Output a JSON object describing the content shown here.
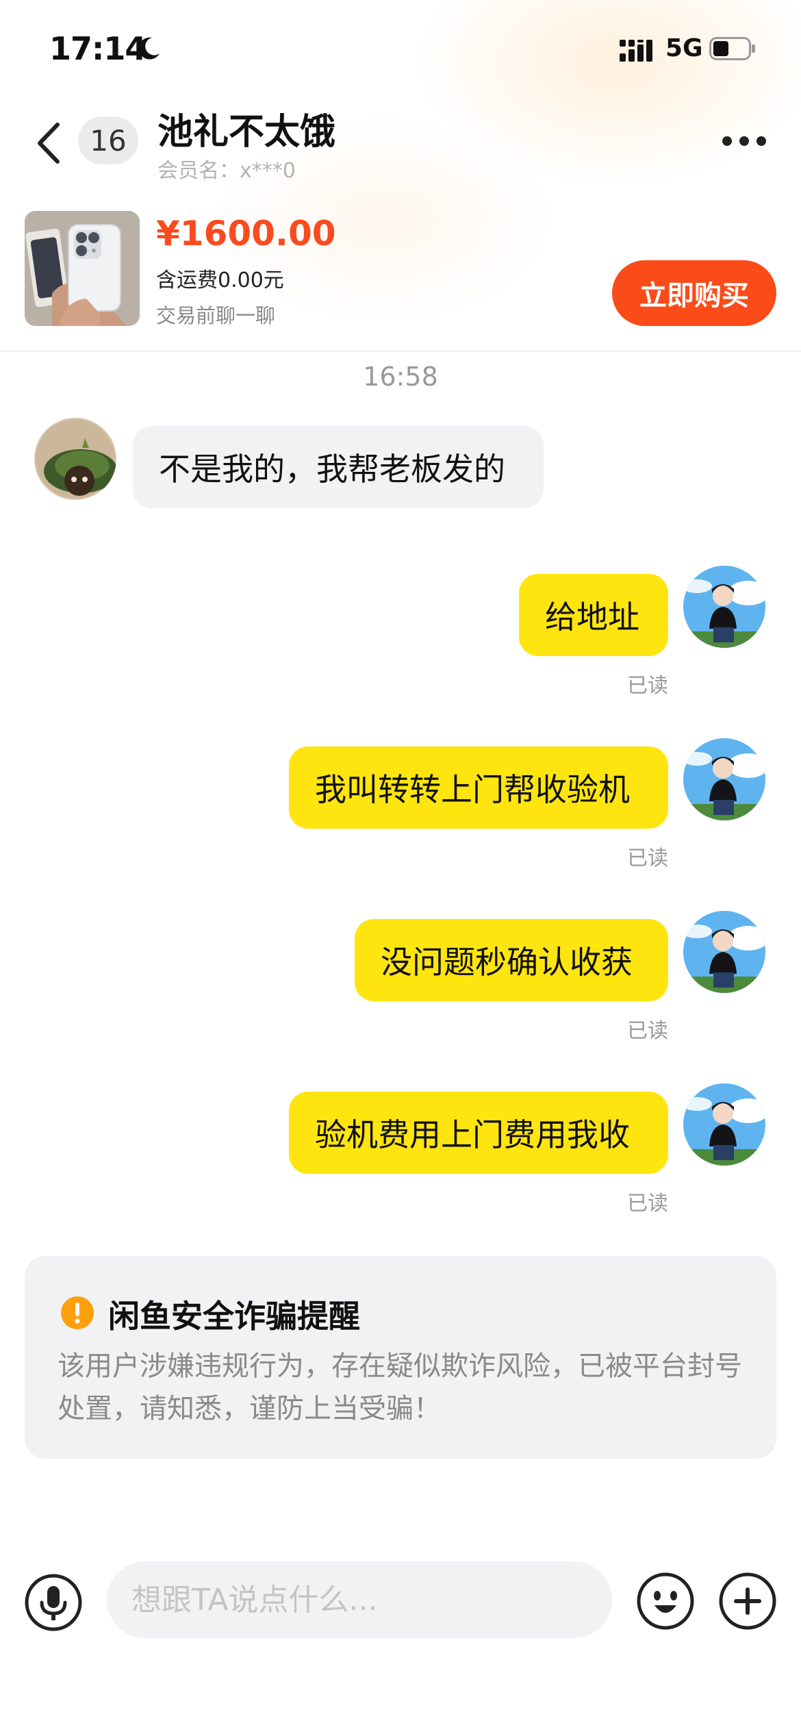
{
  "status_bar": {
    "time": "17:14",
    "network": "5G"
  },
  "nav": {
    "unread_count": "16",
    "chat_name": "池礼不太饿",
    "member_name": "会员名：x***0"
  },
  "product": {
    "price": "¥1600.00",
    "shipping": "含运费0.00元",
    "note": "交易前聊一聊",
    "buy_label": "立即购买"
  },
  "chat": {
    "timestamp": "16:58",
    "messages": [
      {
        "side": "left",
        "text": "不是我的，我帮老板发的"
      },
      {
        "side": "right",
        "text": "给地址",
        "status": "已读"
      },
      {
        "side": "right",
        "text": "我叫转转上门帮收验机",
        "status": "已读"
      },
      {
        "side": "right",
        "text": "没问题秒确认收获",
        "status": "已读"
      },
      {
        "side": "right",
        "text": "验机费用上门费用我收",
        "status": "已读"
      }
    ]
  },
  "warning": {
    "title": "闲鱼安全诈骗提醒",
    "body": "该用户涉嫌违规行为，存在疑似欺诈风险，已被平台封号处置，请知悉，谨防上当受骗！"
  },
  "input_bar": {
    "placeholder": "想跟TA说点什么..."
  },
  "colors": {
    "price": "#f94b1f",
    "buy_button": "#fa4b18",
    "my_bubble": "#ffe50f",
    "their_bubble": "#f2f2f4",
    "warning_icon": "#ff9f0a"
  },
  "icons": [
    "moon-icon",
    "signal-icon",
    "battery-icon",
    "back-icon",
    "more-icon",
    "warning-icon",
    "mic-icon",
    "emoji-icon",
    "plus-icon"
  ]
}
